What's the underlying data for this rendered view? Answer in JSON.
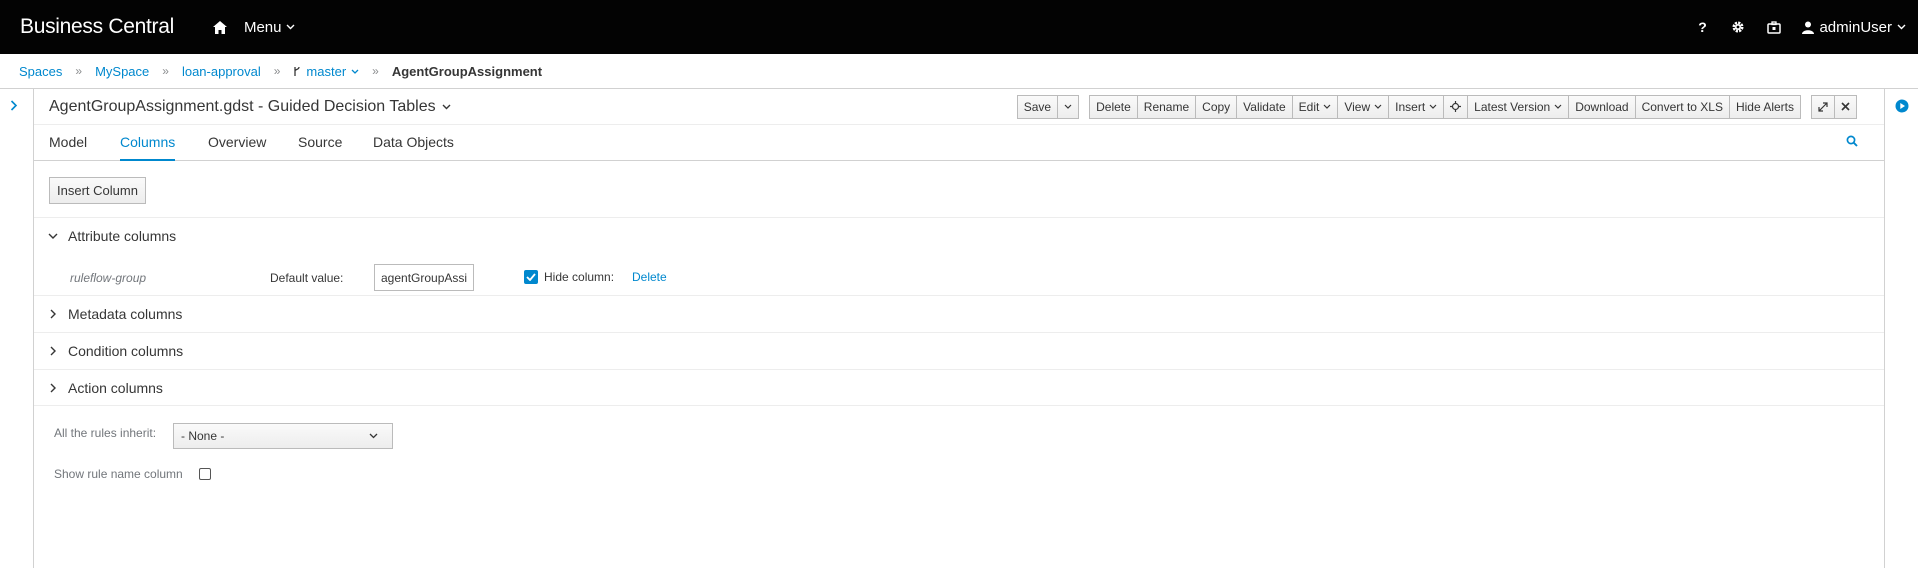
{
  "navbar": {
    "brand": "Business Central",
    "menu_label": "Menu",
    "help_label": "?",
    "user_name": "adminUser"
  },
  "breadcrumb": {
    "items": [
      "Spaces",
      "MySpace",
      "loan-approval",
      "master"
    ],
    "current": "AgentGroupAssignment"
  },
  "editor": {
    "title": "AgentGroupAssignment.gdst - Guided Decision Tables",
    "toolbar": {
      "save": "Save",
      "delete": "Delete",
      "rename": "Rename",
      "copy": "Copy",
      "validate": "Validate",
      "edit": "Edit",
      "view": "View",
      "insert": "Insert",
      "latest_version": "Latest Version",
      "download": "Download",
      "convert": "Convert to XLS",
      "hide_alerts": "Hide Alerts"
    },
    "tabs": [
      "Model",
      "Columns",
      "Overview",
      "Source",
      "Data Objects"
    ],
    "active_tab": "Columns"
  },
  "columns": {
    "insert_column": "Insert Column",
    "sections": {
      "attribute": "Attribute columns",
      "metadata": "Metadata columns",
      "condition": "Condition columns",
      "action": "Action columns"
    },
    "attribute_row": {
      "name": "ruleflow-group",
      "default_label": "Default value:",
      "default_value": "agentGroupAssignment",
      "hide_label": "Hide column:",
      "hide_checked": true,
      "delete": "Delete"
    },
    "inherit_label": "All the rules inherit:",
    "inherit_value": "- None -",
    "show_rule_name_label": "Show rule name column",
    "show_rule_name_checked": false
  },
  "colors": {
    "navbar_bg": "#030303",
    "link": "#0088ce",
    "border": "#d1d1d1"
  }
}
